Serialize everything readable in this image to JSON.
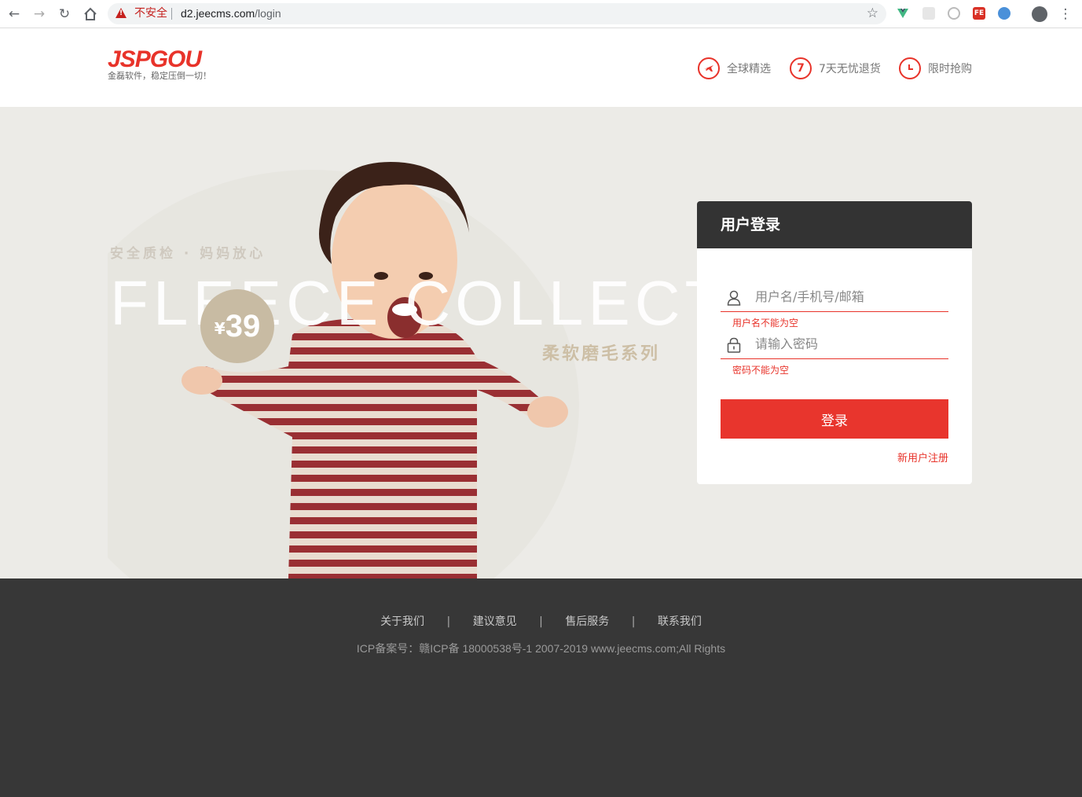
{
  "browser": {
    "security_label": "不安全",
    "url_host": "d2.jeecms.com",
    "url_path": "/login"
  },
  "header": {
    "logo_title": "JSPGOU",
    "logo_subtitle": "金磊软件，稳定压倒一切！",
    "features": [
      {
        "icon": "airplane-icon",
        "label": "全球精选"
      },
      {
        "icon": "seven-icon",
        "glyph": "7",
        "label": "7天无忧退货"
      },
      {
        "icon": "clock-icon",
        "label": "限时抢购"
      }
    ]
  },
  "banner": {
    "slogan": "安全质检 · 妈妈放心",
    "bg_word": "FLEECE COLLECTION",
    "series": "柔软磨毛系列",
    "price_currency": "¥",
    "price_value": "39"
  },
  "login": {
    "title": "用户登录",
    "username_placeholder": "用户名/手机号/邮箱",
    "username_error": "用户名不能为空",
    "password_placeholder": "请输入密码",
    "password_error": "密码不能为空",
    "submit_label": "登录",
    "register_label": "新用户注册"
  },
  "footer": {
    "links": [
      "关于我们",
      "建议意见",
      "售后服务",
      "联系我们"
    ],
    "copyright": "ICP备案号：赣ICP备 18000538号-1 2007-2019 www.jeecms.com;All Rights"
  },
  "colors": {
    "brand_red": "#e8332a",
    "dark_panel": "#333333",
    "footer_bg": "#373737"
  }
}
